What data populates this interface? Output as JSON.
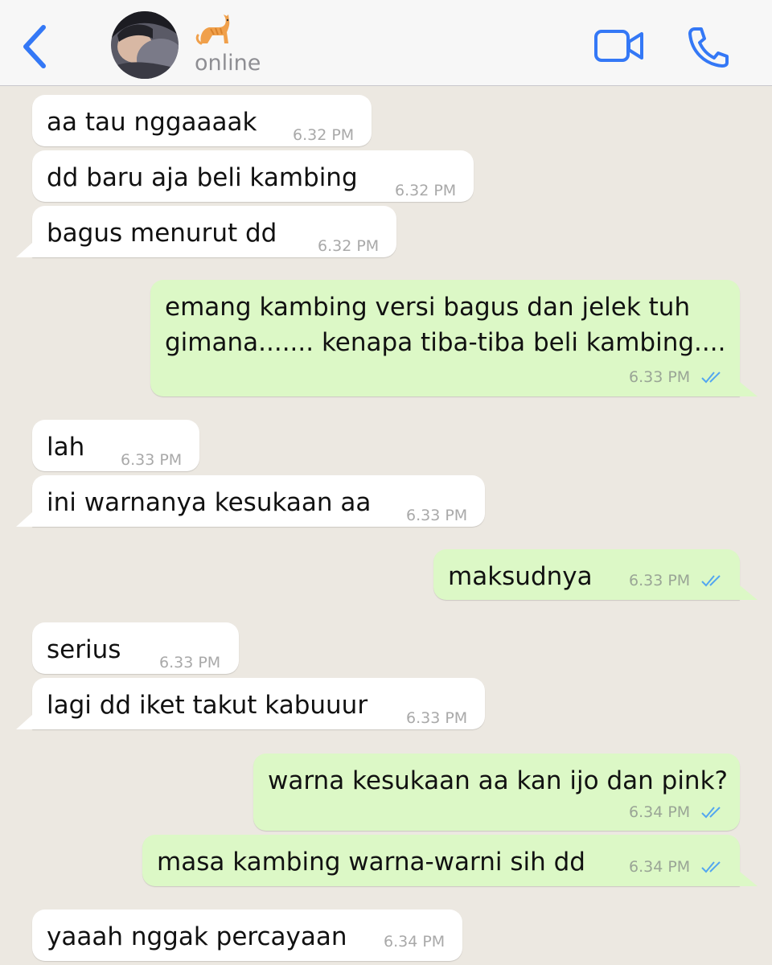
{
  "header": {
    "contact_name_emoji": "🐈",
    "status": "online"
  },
  "colors": {
    "accent": "#3478f6",
    "incoming_bubble": "#ffffff",
    "outgoing_bubble": "#dcf8c6",
    "background": "#ece8e1",
    "read_ticks": "#53a6f0"
  },
  "icons": {
    "back": "chevron-left-icon",
    "video": "video-camera-icon",
    "call": "phone-icon",
    "read": "double-check-icon"
  },
  "messages": [
    {
      "dir": "in",
      "text": "aa tau nggaaaak",
      "time": "6.32 PM"
    },
    {
      "dir": "in",
      "text": "dd baru aja beli kambing",
      "time": "6.32 PM"
    },
    {
      "dir": "in",
      "text": "bagus menurut dd",
      "time": "6.32 PM"
    },
    {
      "dir": "out",
      "text": "emang kambing versi bagus dan jelek tuh\ngimana....... kenapa tiba-tiba beli kambing....",
      "time": "6.33 PM",
      "read": true
    },
    {
      "dir": "in",
      "text": "lah",
      "time": "6.33 PM"
    },
    {
      "dir": "in",
      "text": "ini warnanya kesukaan aa",
      "time": "6.33 PM"
    },
    {
      "dir": "out",
      "text": "maksudnya",
      "time": "6.33 PM",
      "read": true
    },
    {
      "dir": "in",
      "text": "serius",
      "time": "6.33 PM"
    },
    {
      "dir": "in",
      "text": "lagi dd iket takut kabuuur",
      "time": "6.33 PM"
    },
    {
      "dir": "out",
      "text": "warna kesukaan aa kan ijo dan pink?",
      "time": "6.34 PM",
      "read": true
    },
    {
      "dir": "out",
      "text": "masa kambing warna-warni sih dd",
      "time": "6.34 PM",
      "read": true
    },
    {
      "dir": "in",
      "text": "yaaah nggak percayaan",
      "time": "6.34 PM"
    }
  ]
}
